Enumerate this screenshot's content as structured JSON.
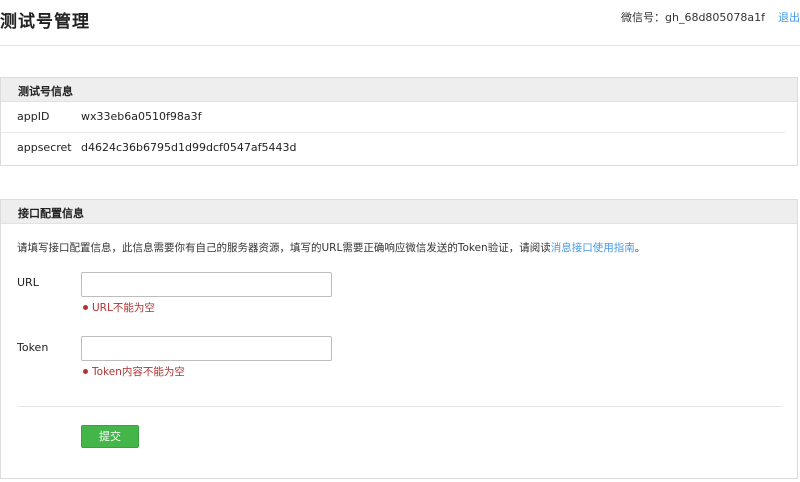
{
  "header": {
    "title": "测试号管理",
    "account_label": "微信号：",
    "account_value": "gh_68d805078a1f",
    "logout": "退出"
  },
  "test_account": {
    "title": "测试号信息",
    "rows": [
      {
        "label": "appID",
        "value": "wx33eb6a0510f98a3f"
      },
      {
        "label": "appsecret",
        "value": "d4624c36b6795d1d99dcf0547af5443d"
      }
    ]
  },
  "interface_config": {
    "title": "接口配置信息",
    "description": "请填写接口配置信息，此信息需要你有自己的服务器资源，填写的URL需要正确响应微信发送的Token验证，请阅读",
    "guide_link": "消息接口使用指南",
    "description_end": "。",
    "url": {
      "label": "URL",
      "value": "",
      "error": "URL不能为空"
    },
    "token": {
      "label": "Token",
      "value": "",
      "error": "Token内容不能为空"
    },
    "submit": "提交"
  },
  "colors": {
    "accent_link": "#459ae9",
    "submit_green": "#44b549",
    "error_red": "#b03434"
  }
}
